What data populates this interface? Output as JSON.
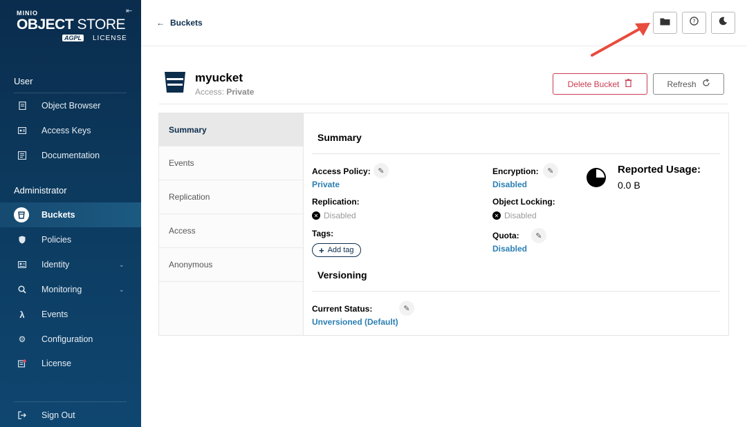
{
  "sidebar": {
    "logo": {
      "brand": "MINIO",
      "title_bold": "OBJECT",
      "title_light": "STORE",
      "badge": "AGPL",
      "license": "LICENSE"
    },
    "sections": [
      {
        "title": "User",
        "items": [
          {
            "label": "Object Browser",
            "icon": "file-icon"
          },
          {
            "label": "Access Keys",
            "icon": "key-card-icon"
          },
          {
            "label": "Documentation",
            "icon": "document-icon"
          }
        ]
      },
      {
        "title": "Administrator",
        "items": [
          {
            "label": "Buckets",
            "icon": "bucket-icon",
            "active": true
          },
          {
            "label": "Policies",
            "icon": "shield-icon"
          },
          {
            "label": "Identity",
            "icon": "id-card-icon",
            "expandable": true
          },
          {
            "label": "Monitoring",
            "icon": "magnifier-icon",
            "expandable": true
          },
          {
            "label": "Events",
            "icon": "lambda-icon"
          },
          {
            "label": "Configuration",
            "icon": "gear-icon"
          },
          {
            "label": "License",
            "icon": "license-icon"
          }
        ]
      }
    ],
    "sign_out": "Sign Out"
  },
  "topbar": {
    "back_label": "Buckets",
    "icons": [
      "folder-icon",
      "help-icon",
      "dark-mode-icon"
    ]
  },
  "header": {
    "bucket_name": "myucket",
    "access_label": "Access:",
    "access_value": "Private",
    "delete_label": "Delete Bucket",
    "refresh_label": "Refresh"
  },
  "tabs": [
    "Summary",
    "Events",
    "Replication",
    "Access",
    "Anonymous"
  ],
  "summary": {
    "title": "Summary",
    "access_policy": {
      "label": "Access Policy:",
      "value": "Private"
    },
    "replication": {
      "label": "Replication:",
      "value": "Disabled"
    },
    "tags": {
      "label": "Tags:",
      "add_label": "Add tag"
    },
    "encryption": {
      "label": "Encryption:",
      "value": "Disabled"
    },
    "object_locking": {
      "label": "Object Locking:",
      "value": "Disabled"
    },
    "quota": {
      "label": "Quota:",
      "value": "Disabled"
    },
    "usage": {
      "label": "Reported Usage:",
      "value": "0.0 B"
    }
  },
  "versioning": {
    "title": "Versioning",
    "status_label": "Current Status:",
    "status_value": "Unversioned (Default)"
  },
  "colors": {
    "sidebar": "#0c3a5e",
    "link": "#2a7fb2",
    "danger": "#c83b51",
    "annotation": "#e84c3d"
  }
}
